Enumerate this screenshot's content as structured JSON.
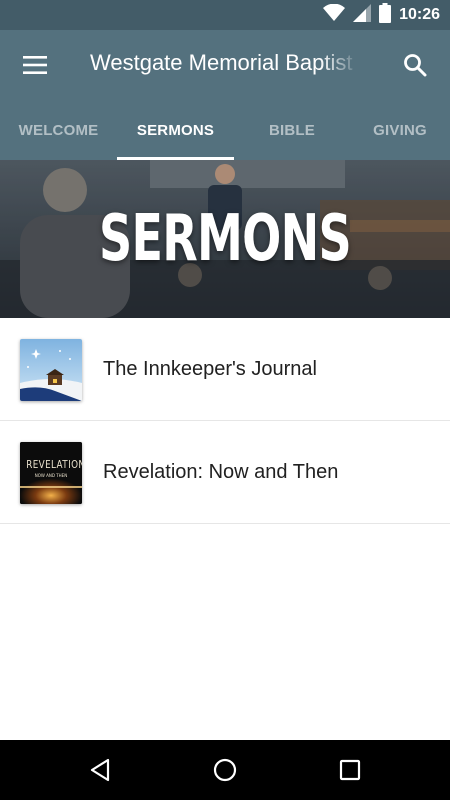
{
  "status_bar": {
    "time": "10:26",
    "icons": [
      "wifi-icon",
      "cell-signal-icon",
      "battery-icon"
    ]
  },
  "app_bar": {
    "title": "Westgate Memorial Baptist",
    "menu_icon": "hamburger-menu-icon",
    "search_icon": "search-icon"
  },
  "tabs": [
    {
      "label": "WELCOME",
      "active": false
    },
    {
      "label": "SERMONS",
      "active": true
    },
    {
      "label": "BIBLE",
      "active": false
    },
    {
      "label": "GIVING",
      "active": false
    }
  ],
  "banner": {
    "title": "SERMONS"
  },
  "sermons": [
    {
      "title": "The Innkeeper's Journal",
      "thumb_icon": "nativity-scene-thumbnail"
    },
    {
      "title": "Revelation: Now and Then",
      "thumb_icon": "revelation-series-thumbnail",
      "thumb_text": "REVELATION",
      "thumb_subtext": "NOW AND THEN"
    }
  ],
  "nav_bar": {
    "icons": [
      "back-icon",
      "home-icon",
      "recents-icon"
    ]
  },
  "colors": {
    "status_bar": "#435c68",
    "app_bar": "#54717e",
    "accent": "#ffffff"
  }
}
